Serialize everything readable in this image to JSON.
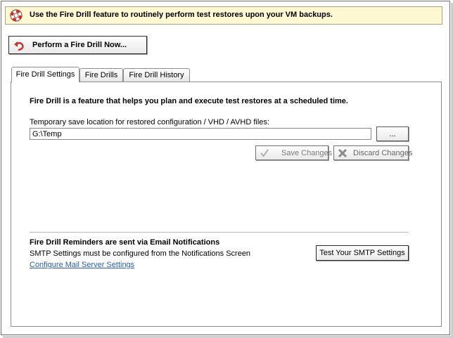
{
  "banner": {
    "text": "Use the Fire Drill feature to routinely perform test restores upon your VM backups."
  },
  "actions": {
    "fire_drill_now": "Perform a Fire Drill Now..."
  },
  "tabs": [
    {
      "label": "Fire Drill Settings",
      "active": true
    },
    {
      "label": "Fire Drills",
      "active": false
    },
    {
      "label": "Fire Drill History",
      "active": false
    }
  ],
  "settings": {
    "intro": "Fire Drill is a feature that helps you plan and execute test restores at a scheduled time.",
    "path_label": "Temporary save location for restored configuration / VHD / AVHD files:",
    "path_value": "G:\\Temp",
    "browse_label": "...",
    "save_label": "Save Changes",
    "discard_label": "Discard Changes"
  },
  "reminders": {
    "title": "Fire Drill Reminders are sent via Email Notifications",
    "subtitle": "SMTP Settings must be configured from the Notifications Screen",
    "link": "Configure Mail Server Settings",
    "test_button": "Test Your SMTP Settings"
  },
  "colors": {
    "banner_bg": "#fdf7d2",
    "link": "#2a5db0",
    "icon_red": "#c8322b"
  },
  "icons": {
    "banner": "lifebuoy-icon",
    "fire_drill": "undo-arrow-icon",
    "save": "checkmark-icon",
    "discard": "x-icon"
  }
}
